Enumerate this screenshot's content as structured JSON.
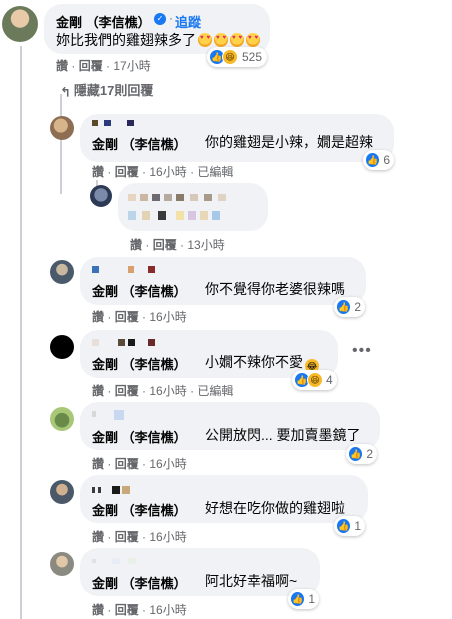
{
  "top_comment": {
    "author": "金剛 （李信樵）",
    "follow": "追蹤",
    "text": "妳比我們的雞翅辣多了",
    "reaction_count": "525",
    "actions": {
      "like": "讚",
      "reply": "回覆",
      "time": "17小時"
    }
  },
  "replies_toggle": "隱藏17則回覆",
  "replies": [
    {
      "author": "金剛 （李信樵）",
      "text": "你的雞翅是小辣，嫺是超辣",
      "like": "讚",
      "reply": "回覆",
      "time": "16小時",
      "edited": "已編輯",
      "reaction_count": "6"
    },
    {
      "like": "讚",
      "reply": "回覆",
      "time": "13小時"
    },
    {
      "author": "金剛 （李信樵）",
      "text": "你不覺得你老婆很辣嗎",
      "like": "讚",
      "reply": "回覆",
      "time": "16小時",
      "reaction_count": "2"
    },
    {
      "author": "金剛 （李信樵）",
      "text": "小嫺不辣你不愛",
      "like": "讚",
      "reply": "回覆",
      "time": "16小時",
      "edited": "已編輯",
      "reaction_count": "4"
    },
    {
      "author": "金剛 （李信樵）",
      "text": "公開放閃... 要加賣墨鏡了",
      "like": "讚",
      "reply": "回覆",
      "time": "16小時",
      "reaction_count": "2"
    },
    {
      "author": "金剛 （李信樵）",
      "text": "好想在吃你做的雞翅啦",
      "like": "讚",
      "reply": "回覆",
      "time": "16小時",
      "reaction_count": "1"
    },
    {
      "author": "金剛 （李信樵）",
      "text": "阿北好幸福啊~",
      "like": "讚",
      "reply": "回覆",
      "time": "16小時",
      "reaction_count": "1"
    }
  ],
  "colors": {
    "accent": "#1877f2",
    "bubble": "#f0f2f5",
    "meta": "#65676b"
  }
}
